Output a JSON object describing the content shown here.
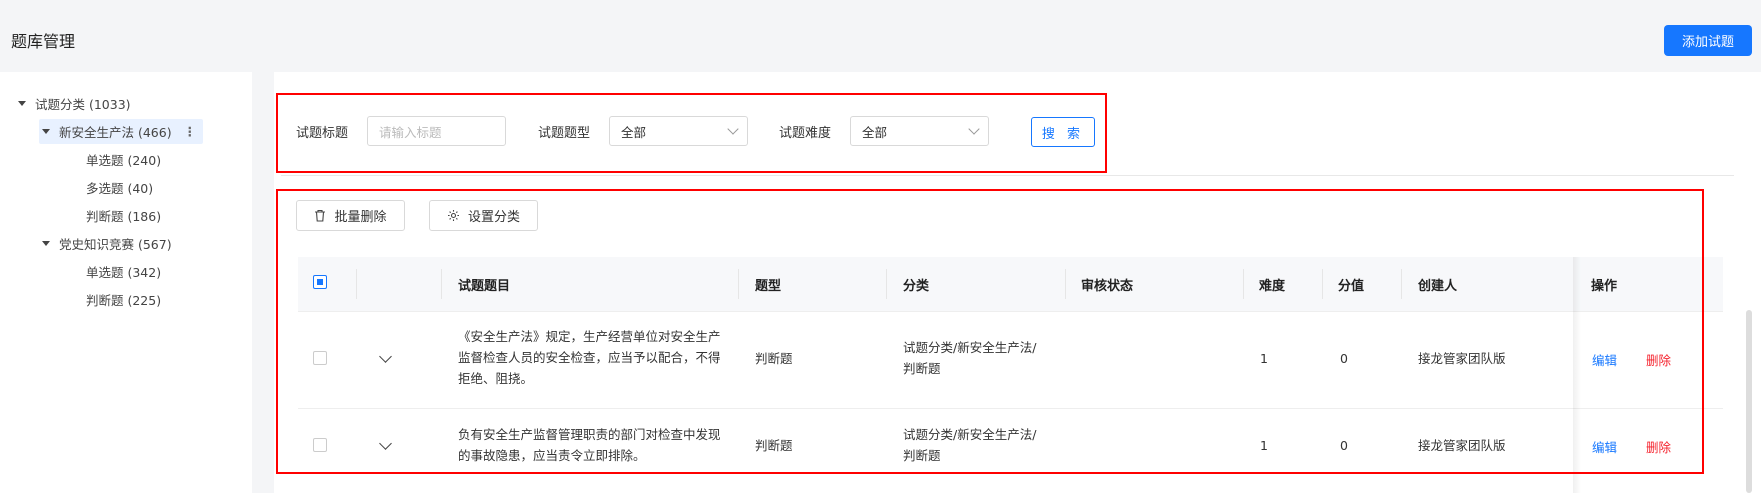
{
  "page": {
    "title": "题库管理",
    "add_button": "添加试题"
  },
  "tree": [
    {
      "label": "试题分类 (1033)"
    },
    {
      "label": "新安全生产法 (466)"
    },
    {
      "label": "单选题 (240)"
    },
    {
      "label": "多选题 (40)"
    },
    {
      "label": "判断题 (186)"
    },
    {
      "label": "党史知识竞赛 (567)"
    },
    {
      "label": "单选题 (342)"
    },
    {
      "label": "判断题 (225)"
    }
  ],
  "filters": {
    "title_label": "试题标题",
    "title_placeholder": "请输入标题",
    "type_label": "试题题型",
    "type_value": "全部",
    "difficulty_label": "试题难度",
    "difficulty_value": "全部",
    "search_button": "搜 索"
  },
  "toolbar": {
    "batch_delete": "批量删除",
    "set_category": "设置分类"
  },
  "table": {
    "headers": [
      "试题题目",
      "题型",
      "分类",
      "审核状态",
      "难度",
      "分值",
      "创建人",
      "操作"
    ],
    "rows": [
      {
        "question": "《安全生产法》规定，生产经营单位对安全生产监督检查人员的安全检查，应当予以配合，不得拒绝、阻挠。",
        "type": "判断题",
        "category": "试题分类/新安全生产法/判断题",
        "status": "",
        "difficulty": "1",
        "score": "0",
        "creator": "接龙管家团队版",
        "edit": "编辑",
        "delete": "删除"
      },
      {
        "question": "负有安全生产监督管理职责的部门对检查中发现的事故隐患，应当责令立即排除。",
        "type": "判断题",
        "category": "试题分类/新安全生产法/判断题",
        "status": "",
        "difficulty": "1",
        "score": "0",
        "creator": "接龙管家团队版",
        "edit": "编辑",
        "delete": "删除"
      }
    ]
  },
  "colors": {
    "primary": "#1677ff",
    "danger": "#f5222d",
    "highlight_box": "#ff0000"
  }
}
